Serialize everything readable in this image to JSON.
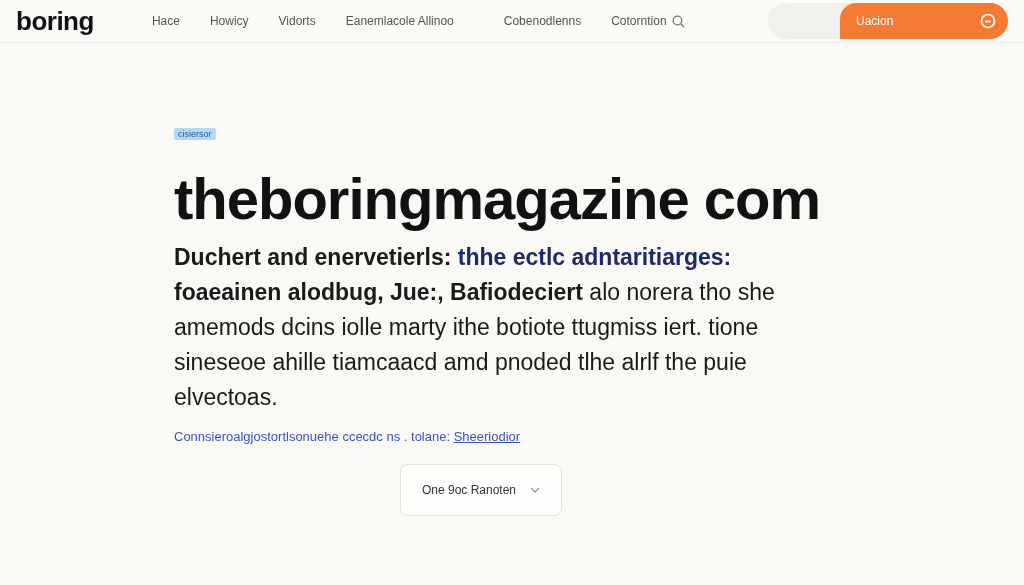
{
  "header": {
    "logo": "boring",
    "nav": [
      {
        "label": "Hace"
      },
      {
        "label": "Howicy"
      },
      {
        "label": "Vidorts"
      },
      {
        "label": "Eanemlacole Allinoo"
      },
      {
        "label": "Cobenodlenns"
      },
      {
        "label": "Cotorntion",
        "search": true
      }
    ],
    "cta": {
      "label": "Uacion"
    }
  },
  "hero": {
    "tag": "cisiersor",
    "title": "theboringmagazine com",
    "lead": "Duchert and enervetierls:",
    "highlight": "thhe ectlc adntaritiarges:",
    "body": "**foaeainen alodbug, Jue:, Bafiodeciert** alo norera tho she amemods dcins iolle marty ithe botiote ttugmiss iert. tione sineseoe ahille tiamcaacd amd pnoded tlhe alrlf the puie elvectoas.",
    "note": "Connsieroalgjostortlsonuehe ccecdc ns . tolane:",
    "note_link": "Sheeriodior",
    "dropdown": "One 9oc Ranoten"
  }
}
